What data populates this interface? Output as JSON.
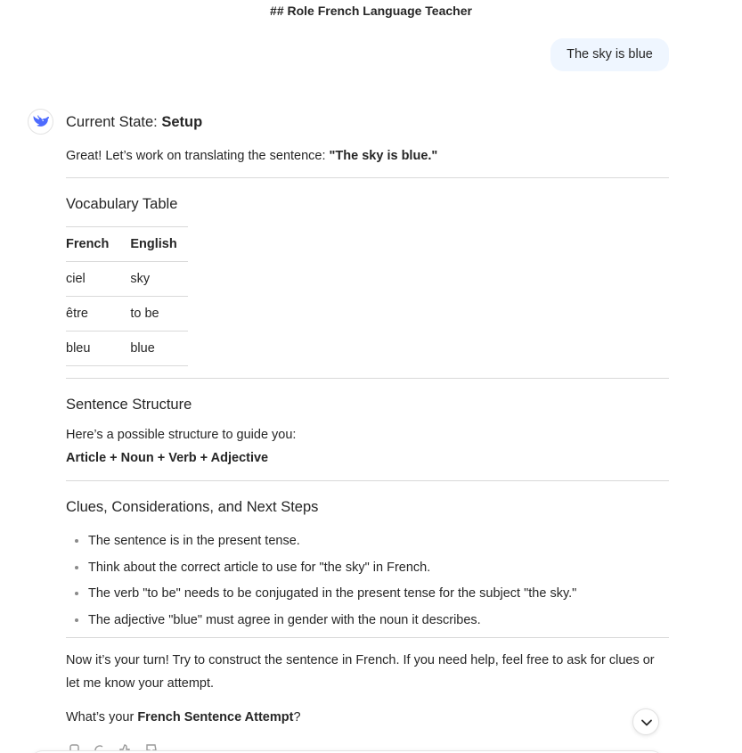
{
  "chat": {
    "title": "## Role French Language Teacher"
  },
  "user_message": {
    "text": "The sky is blue"
  },
  "assistant": {
    "state_label": "Current State: ",
    "state_value": "Setup",
    "intro_text": "Great! Let’s work on translating the sentence: ",
    "intro_sentence": "\"The sky is blue.\"",
    "vocab_heading": "Vocabulary Table",
    "vocab_headers": [
      "French",
      "English"
    ],
    "vocab_rows": [
      [
        "ciel",
        "sky"
      ],
      [
        "être",
        "to be"
      ],
      [
        "bleu",
        "blue"
      ]
    ],
    "structure_heading": "Sentence Structure",
    "structure_intro": "Here’s a possible structure to guide you:",
    "structure_formula": "Article + Noun + Verb + Adjective",
    "clues_heading": "Clues, Considerations, and Next Steps",
    "clues": [
      "The sentence is in the present tense.",
      "Think about the correct article to use for \"the sky\" in French.",
      "The verb \"to be\" needs to be conjugated in the present tense for the subject \"the sky.\"",
      "The adjective \"blue\" must agree in gender with the noun it describes."
    ],
    "closing_text": "Now it’s your turn! Try to construct the sentence in French. If you need help, feel free to ask for clues or let me know your attempt.",
    "question_prefix": "What’s your ",
    "question_bold": "French Sentence Attempt",
    "question_suffix": "?"
  },
  "icons": {
    "avatar": "whale-logo-icon",
    "scroll": "chevron-down-icon",
    "actions": [
      "copy-icon",
      "regenerate-icon",
      "thumbs-up-icon",
      "thumbs-down-icon"
    ]
  },
  "colors": {
    "accent": "#4d6bfe",
    "user_bubble": "#eff6ff",
    "text": "#262626",
    "divider": "#d9d9d9"
  }
}
